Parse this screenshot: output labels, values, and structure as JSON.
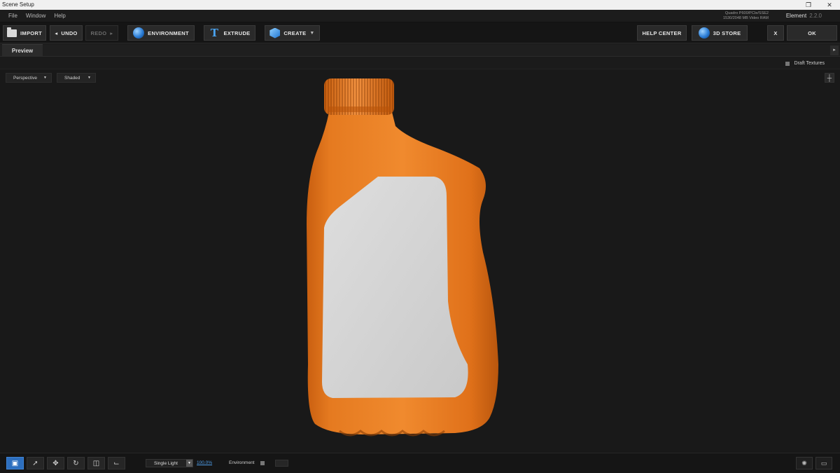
{
  "window": {
    "title": "Scene Setup",
    "maximize_icon": "restore-icon",
    "close_icon": "close-icon"
  },
  "menu": {
    "items": [
      "File",
      "Window",
      "Help"
    ]
  },
  "gpu": {
    "line1": "Quadro P600/PCIe/SSE2",
    "line2": "1530/2048 MB Video RAM"
  },
  "product": {
    "name": "Element",
    "version": "2.2.0"
  },
  "toolbar": {
    "import": "IMPORT",
    "undo": "UNDO",
    "redo": "REDO",
    "environment": "ENVIRONMENT",
    "extrude": "EXTRUDE",
    "create": "CREATE",
    "help_center": "HELP CENTER",
    "store": "3D STORE",
    "cancel": "X",
    "ok": "OK"
  },
  "panel": {
    "tab": "Preview",
    "draft_textures": "Draft Textures",
    "draft_textures_checked": false
  },
  "viewport": {
    "camera_mode": "Perspective",
    "shading_mode": "Shaded",
    "object_color": "#e8781e",
    "label_color": "#d4d4d4"
  },
  "bottom": {
    "tools": [
      "camera-icon",
      "select-icon",
      "move-icon",
      "rotate-icon",
      "scale-icon",
      "axis-icon"
    ],
    "active_tool": "move-icon",
    "light_mode": "Single Light",
    "light_intensity": "100.0%",
    "environment_label": "Environment",
    "environment_checked": false
  },
  "colors": {
    "accent": "#2d6fbf",
    "link": "#4e9de8"
  }
}
